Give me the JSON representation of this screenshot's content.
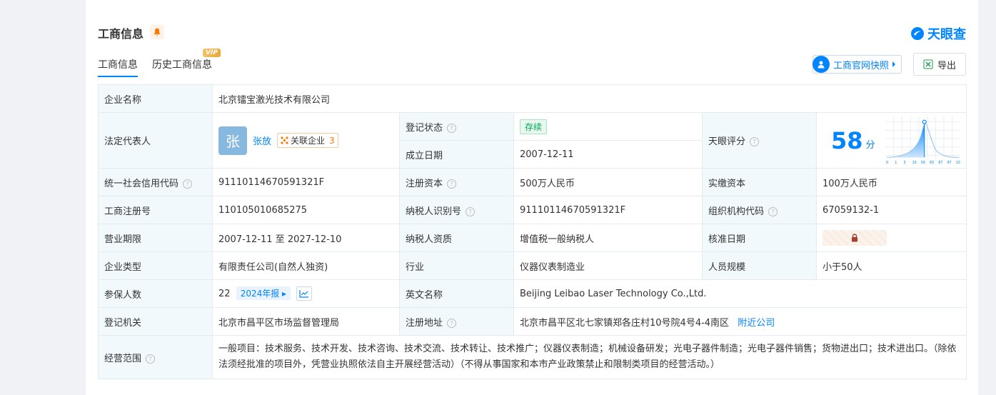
{
  "section_title": "工商信息",
  "logo_text": "天眼查",
  "tabs": [
    {
      "label": "工商信息",
      "active": true
    },
    {
      "label": "历史工商信息",
      "active": false
    }
  ],
  "vip_badge": "VIP",
  "snapshot_button": "工商官网快照",
  "export_button": "导出",
  "rows": {
    "company_name_label": "企业名称",
    "company_name": "北京镭宝激光技术有限公司",
    "legal_rep_label": "法定代表人",
    "legal_rep_avatar": "张",
    "legal_rep_name": "张放",
    "associated_label": "关联企业",
    "associated_count": "3",
    "reg_status_label": "登记状态",
    "reg_status": "存续",
    "founded_label": "成立日期",
    "founded": "2007-12-11",
    "score_label": "天眼评分",
    "score": "58",
    "score_unit": "分",
    "credit_code_label": "统一社会信用代码",
    "credit_code": "91110114670591321F",
    "reg_capital_label": "注册资本",
    "reg_capital": "500万人民币",
    "paid_capital_label": "实缴资本",
    "paid_capital": "100万人民币",
    "biz_reg_no_label": "工商注册号",
    "biz_reg_no": "110105010685275",
    "taxpayer_id_label": "纳税人识别号",
    "taxpayer_id": "91110114670591321F",
    "org_code_label": "组织机构代码",
    "org_code": "67059132-1",
    "term_label": "营业期限",
    "term": "2007-12-11 至 2027-12-10",
    "taxpayer_qual_label": "纳税人资质",
    "taxpayer_qual": "增值税一般纳税人",
    "approval_date_label": "核准日期",
    "company_type_label": "企业类型",
    "company_type": "有限责任公司(自然人独资)",
    "industry_label": "行业",
    "industry": "仪器仪表制造业",
    "staff_size_label": "人员规模",
    "staff_size": "小于50人",
    "insured_label": "参保人数",
    "insured": "22",
    "report_year": "2024年报",
    "english_name_label": "英文名称",
    "english_name": "Beijing Leibao Laser Technology Co.,Ltd.",
    "authority_label": "登记机关",
    "authority": "北京市昌平区市场监督管理局",
    "address_label": "注册地址",
    "address": "北京市昌平区北七家镇郑各庄村10号院4号4-4南区",
    "nearby_link": "附近公司",
    "scope_label": "经营范围",
    "scope": "一般项目：技术服务、技术开发、技术咨询、技术交流、技术转让、技术推广；仪器仪表制造；机械设备研发；光电子器件制造；光电子器件销售；货物进出口；技术进出口。（除依法须经批准的项目外，凭营业执照依法自主开展经营活动）（不得从事国家和本市产业政策禁止和限制类项目的经营活动。）"
  },
  "score_chart": {
    "ticks": [
      "0",
      "1",
      "3",
      "15",
      "50",
      "65",
      "87",
      "97",
      "100"
    ]
  },
  "colors": {
    "accent": "#0084ff",
    "label_bg": "#f2f9fc",
    "status_green": "#00a65a"
  }
}
